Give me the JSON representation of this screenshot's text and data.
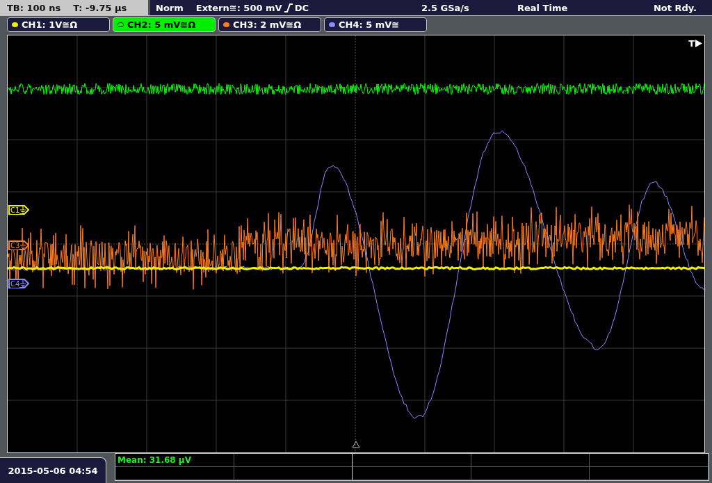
{
  "status_bar": {
    "timebase": "TB: 100 ns",
    "trigger_time": "T: -9.75 µs",
    "mode": "Norm",
    "trigger": "Extern≅: 500 mV",
    "coupling": "DC",
    "sample_rate": "2.5 GSa/s",
    "acquisition": "Real Time",
    "state": "Not Rdy."
  },
  "channels": [
    {
      "label": "CH1: 1V≅Ω",
      "color": "#f0f000",
      "selected": false
    },
    {
      "label": "CH2: 5 mV≅Ω",
      "color": "#00ff00",
      "selected": true
    },
    {
      "label": "CH3: 2 mV≅Ω",
      "color": "#ff7f1f",
      "selected": false
    },
    {
      "label": "CH4: 5 mV≅",
      "color": "#8c8cff",
      "selected": false
    }
  ],
  "markers": [
    {
      "label": "C1",
      "color": "#f0f000"
    },
    {
      "label": "C3",
      "color": "#ff7f1f"
    },
    {
      "label": "C4",
      "color": "#8c8cff"
    }
  ],
  "trigger_marker": "T",
  "measurement": "Mean: 31.68 µV",
  "date": "2015-05-06 04:54"
}
